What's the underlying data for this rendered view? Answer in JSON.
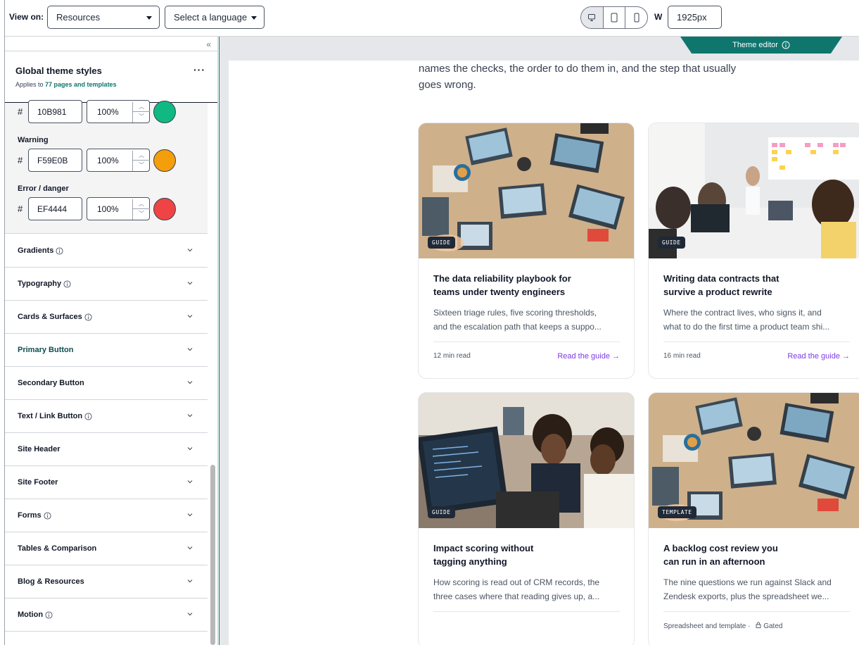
{
  "topbar": {
    "view_on_label": "View on:",
    "view_select": "Resources",
    "language_select": "Select a language",
    "devices": [
      {
        "name": "desktop-icon",
        "active": true
      },
      {
        "name": "tablet-icon",
        "active": false
      },
      {
        "name": "mobile-icon",
        "active": false
      }
    ],
    "width_label": "W",
    "width_value": "1925px"
  },
  "sidebar": {
    "collapse_glyph": "«",
    "title": "Global theme styles",
    "subtitle_prefix": "Applies to ",
    "subtitle_link": "77 pages and templates",
    "menu_glyph": "···",
    "colors": [
      {
        "label": "",
        "hex": "10B981",
        "opacity": "100%",
        "swatch": "#10B981"
      },
      {
        "label": "Warning",
        "hex": "F59E0B",
        "opacity": "100%",
        "swatch": "#F59E0B"
      },
      {
        "label": "Error / danger",
        "hex": "EF4444",
        "opacity": "100%",
        "swatch": "#EF4444"
      }
    ],
    "sections": [
      {
        "label": "Gradients",
        "info": true,
        "active": false
      },
      {
        "label": "Typography",
        "info": true,
        "active": false
      },
      {
        "label": "Cards & Surfaces",
        "info": true,
        "active": false
      },
      {
        "label": "Primary Button",
        "info": false,
        "active": true
      },
      {
        "label": "Secondary Button",
        "info": false,
        "active": false
      },
      {
        "label": "Text / Link Button",
        "info": true,
        "active": false
      },
      {
        "label": "Site Header",
        "info": false,
        "active": false
      },
      {
        "label": "Site Footer",
        "info": false,
        "active": false
      },
      {
        "label": "Forms",
        "info": true,
        "active": false
      },
      {
        "label": "Tables & Comparison",
        "info": false,
        "active": false
      },
      {
        "label": "Blog & Resources",
        "info": false,
        "active": false
      },
      {
        "label": "Motion",
        "info": true,
        "active": false
      }
    ]
  },
  "preview": {
    "theme_editor_label": "Theme editor",
    "intro_line1": "names the checks, the order to do them in, and the step that usually",
    "intro_line2": "goes wrong.",
    "cards": [
      {
        "badge": "GUIDE",
        "title_line1": "The data reliability playbook for",
        "title_line2": "teams under twenty engineers",
        "desc_line1": "Sixteen triage rules, five scoring thresholds,",
        "desc_line2": "and the escalation path that keeps a suppo...",
        "meta": "12 min read",
        "link": "Read the guide →",
        "photo": "desk-overhead"
      },
      {
        "badge": "GUIDE",
        "title_line1": "Writing data contracts that",
        "title_line2": "survive a product rewrite",
        "desc_line1": "Where the contract lives, who signs it, and",
        "desc_line2": "what to do the first time a product team shi...",
        "meta": "16 min read",
        "link": "Read the guide →",
        "photo": "meeting-room"
      },
      {
        "badge": "GUIDE",
        "title_line1": "Impact scoring without",
        "title_line2": "tagging anything",
        "desc_line1": "How scoring is read out of CRM records, the",
        "desc_line2": "three cases where that reading gives up, a...",
        "meta": "",
        "link": "",
        "photo": "office-laptop"
      },
      {
        "badge": "TEMPLATE",
        "title_line1": "A backlog cost review you",
        "title_line2": "can run in an afternoon",
        "desc_line1": "The nine questions we run against Slack and",
        "desc_line2": "Zendesk exports, plus the spreadsheet we...",
        "meta": "Spreadsheet and template",
        "gated": "Gated",
        "link": "",
        "photo": "desk-overhead"
      }
    ]
  }
}
